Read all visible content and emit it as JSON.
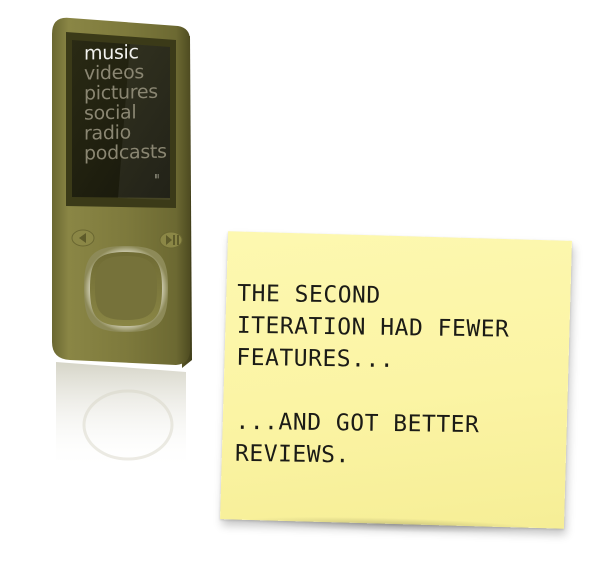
{
  "device": {
    "menu_items": [
      "music",
      "videos",
      "pictures",
      "social",
      "radio",
      "podcasts"
    ],
    "active_item": "music",
    "screen_glyph": "≡",
    "colors": {
      "body": "#7e7a3e",
      "body_dark": "#5b5829",
      "screen": "#23230f",
      "menu_dim": "#8a8672",
      "menu_active": "#f2f2ee"
    }
  },
  "note": {
    "lines": [
      "The second",
      "iteration had fewer",
      "features..."
    ],
    "lines2": [
      "...and got better",
      "reviews."
    ],
    "color": "#fbf4a4"
  }
}
